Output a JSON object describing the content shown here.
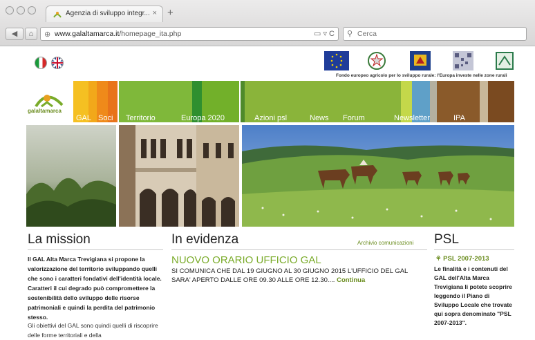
{
  "browser": {
    "tab_title": "Agenzia di sviluppo integr...",
    "tab_close": "×",
    "new_tab": "+",
    "url_domain": "www.galaltamarca.it",
    "url_path": "/homepage_ita.php",
    "url_tools": "▭ ▿ C",
    "search_placeholder": "Cerca"
  },
  "header": {
    "funding_text": "Fondo europeo agricolo per lo sviluppo rurale: l'Europa investe nelle zone rurali",
    "logo_text": "galaltamarca"
  },
  "nav": {
    "items": [
      "GAL",
      "Soci",
      "Territorio",
      "Europa 2020",
      "Azioni psl",
      "News",
      "Forum",
      "Newsletter",
      "IPA"
    ]
  },
  "mission": {
    "title": "La mission",
    "para1": "Il GAL Alta Marca Trevigiana si propone la valorizzazione del territorio sviluppando quelli che sono i caratteri fondativi dell'identità locale. Caratteri il cui degrado può compromettere la sostenibilità dello sviluppo delle risorse patrimoniali e quindi la perdita del patrimonio stesso.",
    "para2": "Gli obiettivi del GAL sono quindi quelli di riscoprire delle forme territoriali e della"
  },
  "evidenza": {
    "title": "In evidenza",
    "archive_link": "Archivio comunicazioni",
    "news_title": "NUOVO ORARIO UFFICIO GAL",
    "news_body": "SI COMUNICA CHE DAL 19 GIUGNO AL 30 GIUGNO 2015 L'UFFICIO DEL GAL SARA' APERTO DALLE ORE 09.30 ALLE ORE 12.30....",
    "more_link": "Continua"
  },
  "psl": {
    "title": "PSL",
    "link": "PSL 2007-2013",
    "body": "Le finalità e i contenuti del GAL dell'Alta Marca Trevigiana li potete scoprire leggendo il Piano di Sviluppo Locale che trovate qui sopra denominato \"PSL 2007-2013\"."
  },
  "colors": {
    "brand_green": "#7aab2a",
    "link_green": "#6a8c1e"
  }
}
